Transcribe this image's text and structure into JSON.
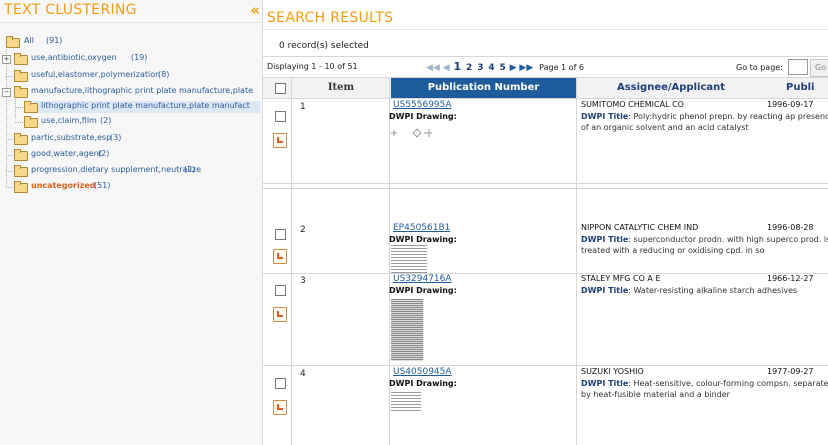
{
  "left": {
    "title": "TEXT CLUSTERING",
    "collapse_glyph": "«",
    "tree": [
      {
        "label": "All",
        "count": "(91)"
      },
      {
        "label": "use,antibiotic,oxygen",
        "count": "(19)"
      },
      {
        "label": "useful,elastomer,polymerization",
        "count": "(8)"
      },
      {
        "label": "manufacture,lithographic print plate manufacture,plate",
        "count": ""
      },
      {
        "label": "lithographic print plate manufacture,plate manufact",
        "count": ""
      },
      {
        "label": "use,claim,film",
        "count": "(2)"
      },
      {
        "label": "partic,substrate,esp",
        "count": "(3)"
      },
      {
        "label": "good,water,agent",
        "count": "(2)"
      },
      {
        "label": "progression,dietary supplement,neutralize",
        "count": "(2)"
      },
      {
        "label": "uncategorized",
        "count": "(51)"
      }
    ]
  },
  "right": {
    "title": "SEARCH RESULTS",
    "selected_text": "0 record(s) selected",
    "displaying": "Displaying 1 - 10 of 51",
    "pages": [
      "1",
      "2",
      "3",
      "4",
      "5"
    ],
    "page_of": "Page 1 of 6",
    "goto_label": "Go to page:",
    "go_label": "Go",
    "headers": {
      "item": "Item",
      "pub": "Publication Number",
      "assignee": "Assignee/Applicant",
      "pubdate": "Publi"
    },
    "dwpi_drawing_label": "DWPI Drawing:",
    "dwpi_title_label": "DWPI Title",
    "rows": [
      {
        "num": "1",
        "pub": "US5556995A",
        "assignee": "SUMITOMO CHEMICAL CO",
        "date": "1996-09-17",
        "title": ": Poly:hydric phenol prepn. by reacting ap presence of an organic solvent and an acid catalyst"
      },
      {
        "num": "2",
        "pub": "EP450561B1",
        "assignee": "NIPPON CATALYTIC CHEM IND",
        "date": "1996-08-28",
        "title": ": superconductor prodn. with high superco prod. is treated with a reducing or oxidising cpd. in so"
      },
      {
        "num": "3",
        "pub": "US3294716A",
        "assignee": "STALEY MFG CO A E",
        "date": "1966-12-27",
        "title": ": Water-resisting alkaline starch adhesives"
      },
      {
        "num": "4",
        "pub": "US4050945A",
        "assignee": "SUZUKI YOSHIO",
        "date": "1977-09-27",
        "title": ": Heat-sensitive, colour-forming compsn. separated by heat-fusible material and a binder"
      }
    ]
  },
  "colors": {
    "accent": "#f39c12",
    "link": "#1f5c9c",
    "header_active": "#1f5c9c",
    "uncategorized": "#e06020"
  }
}
